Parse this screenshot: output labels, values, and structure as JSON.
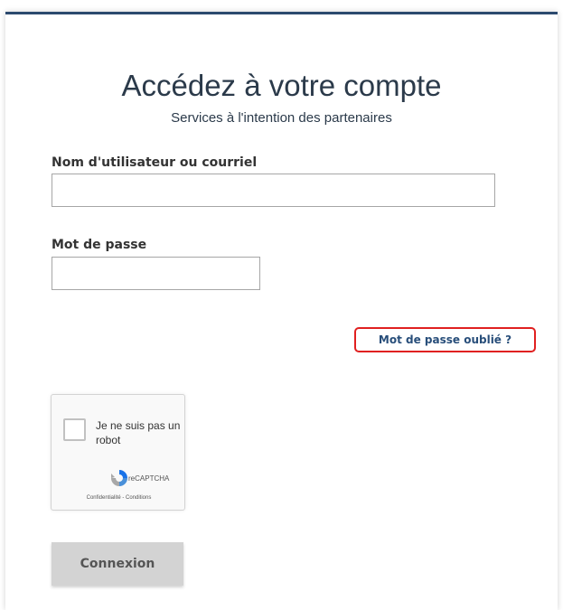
{
  "header": {
    "title": "Accédez à votre compte",
    "subtitle": "Services à l'intention des partenaires"
  },
  "form": {
    "username_label": "Nom d'utilisateur ou courriel",
    "username_value": "",
    "password_label": "Mot de passe",
    "password_value": "",
    "forgot_password": "Mot de passe oublié ?",
    "submit_label": "Connexion"
  },
  "captcha": {
    "text": "Je ne suis pas un robot",
    "brand": "reCAPTCHA",
    "links": "Confidentialité - Conditions"
  },
  "colors": {
    "accent_border": "#2c4a6e",
    "link": "#284e7a",
    "highlight": "#e02020",
    "button_disabled": "#d3d3d3"
  }
}
